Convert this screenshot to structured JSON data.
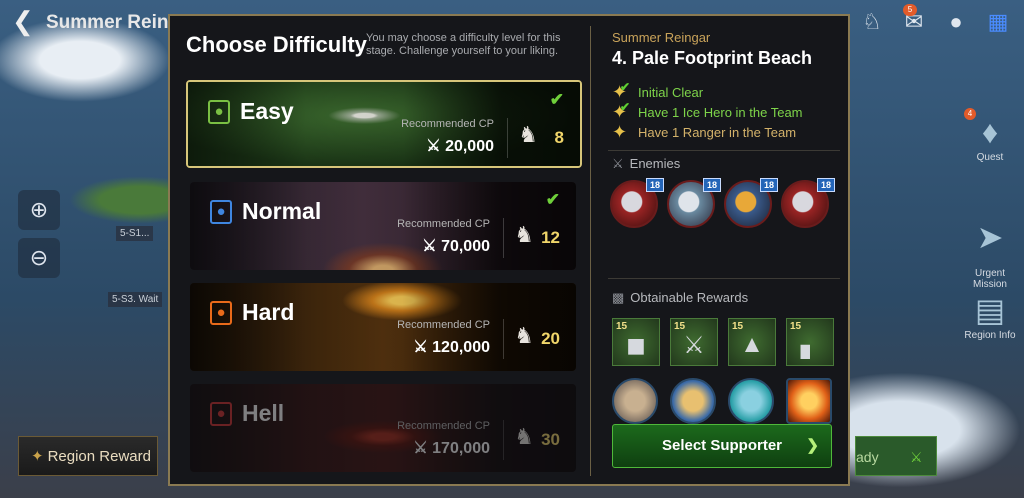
{
  "map": {
    "title": "Summer Reingar",
    "node_labels": [
      "5-S1...",
      "5-S3. Wait"
    ],
    "region_reward_label": "Region Reward",
    "ready_label": "ady"
  },
  "sidebar": {
    "items": [
      {
        "label": "Quest",
        "icon": "quest-crest-icon",
        "badge": "4"
      },
      {
        "label": "Urgent\nMission",
        "icon": "urgent-mission-icon"
      },
      {
        "label": "Region Info",
        "icon": "region-map-icon"
      }
    ]
  },
  "topbar": {
    "mail_badge": "5"
  },
  "panel": {
    "title": "Choose Difficulty",
    "description": "You may choose a difficulty level for this stage. Challenge yourself to your liking.",
    "difficulties": [
      {
        "name": "Easy",
        "recommended_label": "Recommended CP",
        "cp": "20,000",
        "cost": "8",
        "cleared": true,
        "selected": true,
        "color": "#7ac043"
      },
      {
        "name": "Normal",
        "recommended_label": "Recommended CP",
        "cp": "70,000",
        "cost": "12",
        "cleared": true,
        "selected": false,
        "color": "#3f86e0"
      },
      {
        "name": "Hard",
        "recommended_label": "Recommended CP",
        "cp": "120,000",
        "cost": "20",
        "cleared": false,
        "selected": false,
        "color": "#e86a1a"
      },
      {
        "name": "Hell",
        "recommended_label": "Recommended CP",
        "cp": "170,000",
        "cost": "30",
        "cleared": false,
        "selected": false,
        "locked": true,
        "color": "#d23030"
      }
    ],
    "check_glyph": "✔",
    "stage": {
      "region": "Summer Reingar",
      "name": "4. Pale Footprint Beach",
      "missions": [
        {
          "text": "Initial Clear",
          "done": true,
          "color": "#7ed44a"
        },
        {
          "text": "Have 1 Ice Hero in the Team",
          "done": true,
          "color": "#7ed44a"
        },
        {
          "text": "Have 1 Ranger in the Team",
          "done": false,
          "color": "#d3b26a"
        }
      ],
      "enemies_label": "Enemies",
      "enemies": [
        {
          "level": "18",
          "icon": "red-dragon-icon"
        },
        {
          "level": "18",
          "icon": "shark-monster-icon"
        },
        {
          "level": "18",
          "icon": "armored-crab-icon"
        },
        {
          "level": "18",
          "icon": "red-dragon-icon"
        }
      ],
      "rewards_label": "Obtainable Rewards",
      "rewards": [
        {
          "level": "15",
          "icon": "chest-armor-icon"
        },
        {
          "level": "15",
          "icon": "halberd-icon"
        },
        {
          "level": "15",
          "icon": "helmet-icon"
        },
        {
          "level": "15",
          "icon": "boots-icon"
        }
      ],
      "heroes": [
        {
          "icon": "hero-portrait-1-icon",
          "color": "#8a7a6a"
        },
        {
          "icon": "hero-portrait-2-icon",
          "color": "#3a6aa8"
        },
        {
          "icon": "hero-portrait-3-icon",
          "color": "#2aa0a8"
        },
        {
          "icon": "hero-portrait-4-icon",
          "color": "#c05018"
        }
      ],
      "select_supporter_label": "Select Supporter"
    }
  }
}
